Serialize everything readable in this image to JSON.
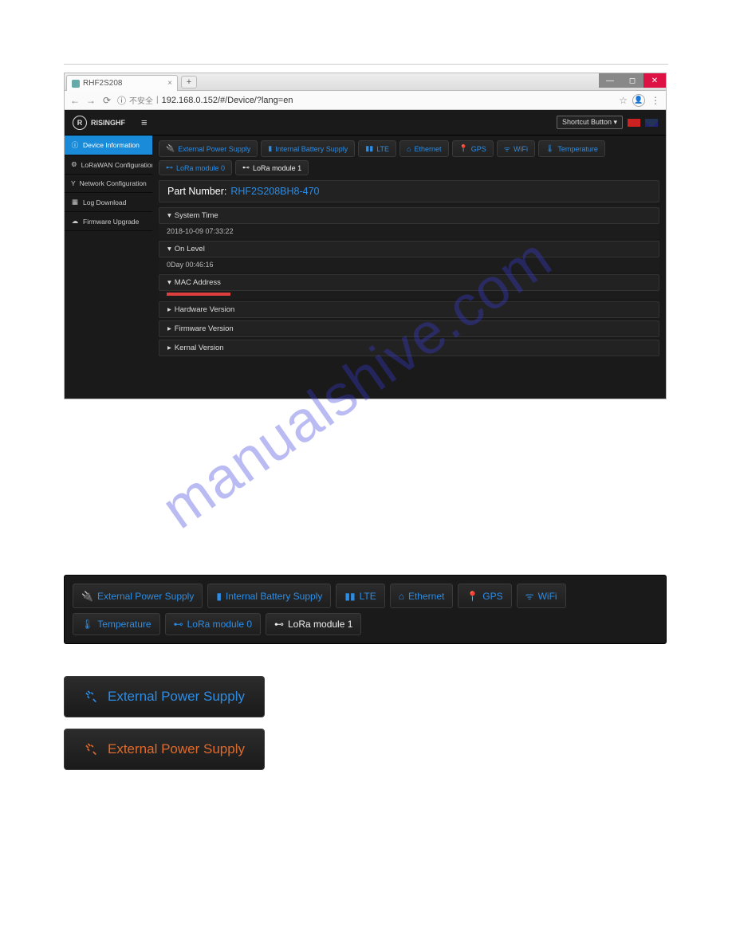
{
  "browser": {
    "tab_title": "RHF2S208",
    "insecure": "不安全",
    "url": "192.168.0.152/#/Device/?lang=en"
  },
  "header": {
    "brand": "RISINGHF",
    "shortcut_label": "Shortcut Button ▾"
  },
  "sidebar": {
    "items": [
      {
        "icon": "ⓘ",
        "label": "Device Information"
      },
      {
        "icon": "⚙",
        "label": "LoRaWAN Configuration"
      },
      {
        "icon": "Y",
        "label": "Network Configuration"
      },
      {
        "icon": "▦",
        "label": "Log Download"
      },
      {
        "icon": "☁",
        "label": "Firmware Upgrade"
      }
    ]
  },
  "status_tabs": [
    {
      "icon": "plug",
      "label": "External Power Supply"
    },
    {
      "icon": "battery",
      "label": "Internal Battery Supply"
    },
    {
      "icon": "signal",
      "label": "LTE"
    },
    {
      "icon": "eth",
      "label": "Ethernet"
    },
    {
      "icon": "pin",
      "label": "GPS"
    },
    {
      "icon": "wifi",
      "label": "WiFi"
    },
    {
      "icon": "temp",
      "label": "Temperature"
    },
    {
      "icon": "lora",
      "label": "LoRa module 0"
    },
    {
      "icon": "lora",
      "label": "LoRa module 1"
    }
  ],
  "part": {
    "label": "Part Number:",
    "value": "RHF2S208BH8-470"
  },
  "accordion": [
    {
      "title": "System Time",
      "open": true,
      "body": "2018-10-09 07:33:22"
    },
    {
      "title": "On Level",
      "open": true,
      "body": "0Day 00:46:16"
    },
    {
      "title": "MAC Address",
      "open": true,
      "body": "[redacted]"
    },
    {
      "title": "Hardware Version",
      "open": false
    },
    {
      "title": "Firmware Version",
      "open": false
    },
    {
      "title": "Kernal Version",
      "open": false
    }
  ],
  "big_button_blue": "External Power Supply",
  "big_button_orange": "External Power Supply",
  "watermark": "manualshive.com"
}
